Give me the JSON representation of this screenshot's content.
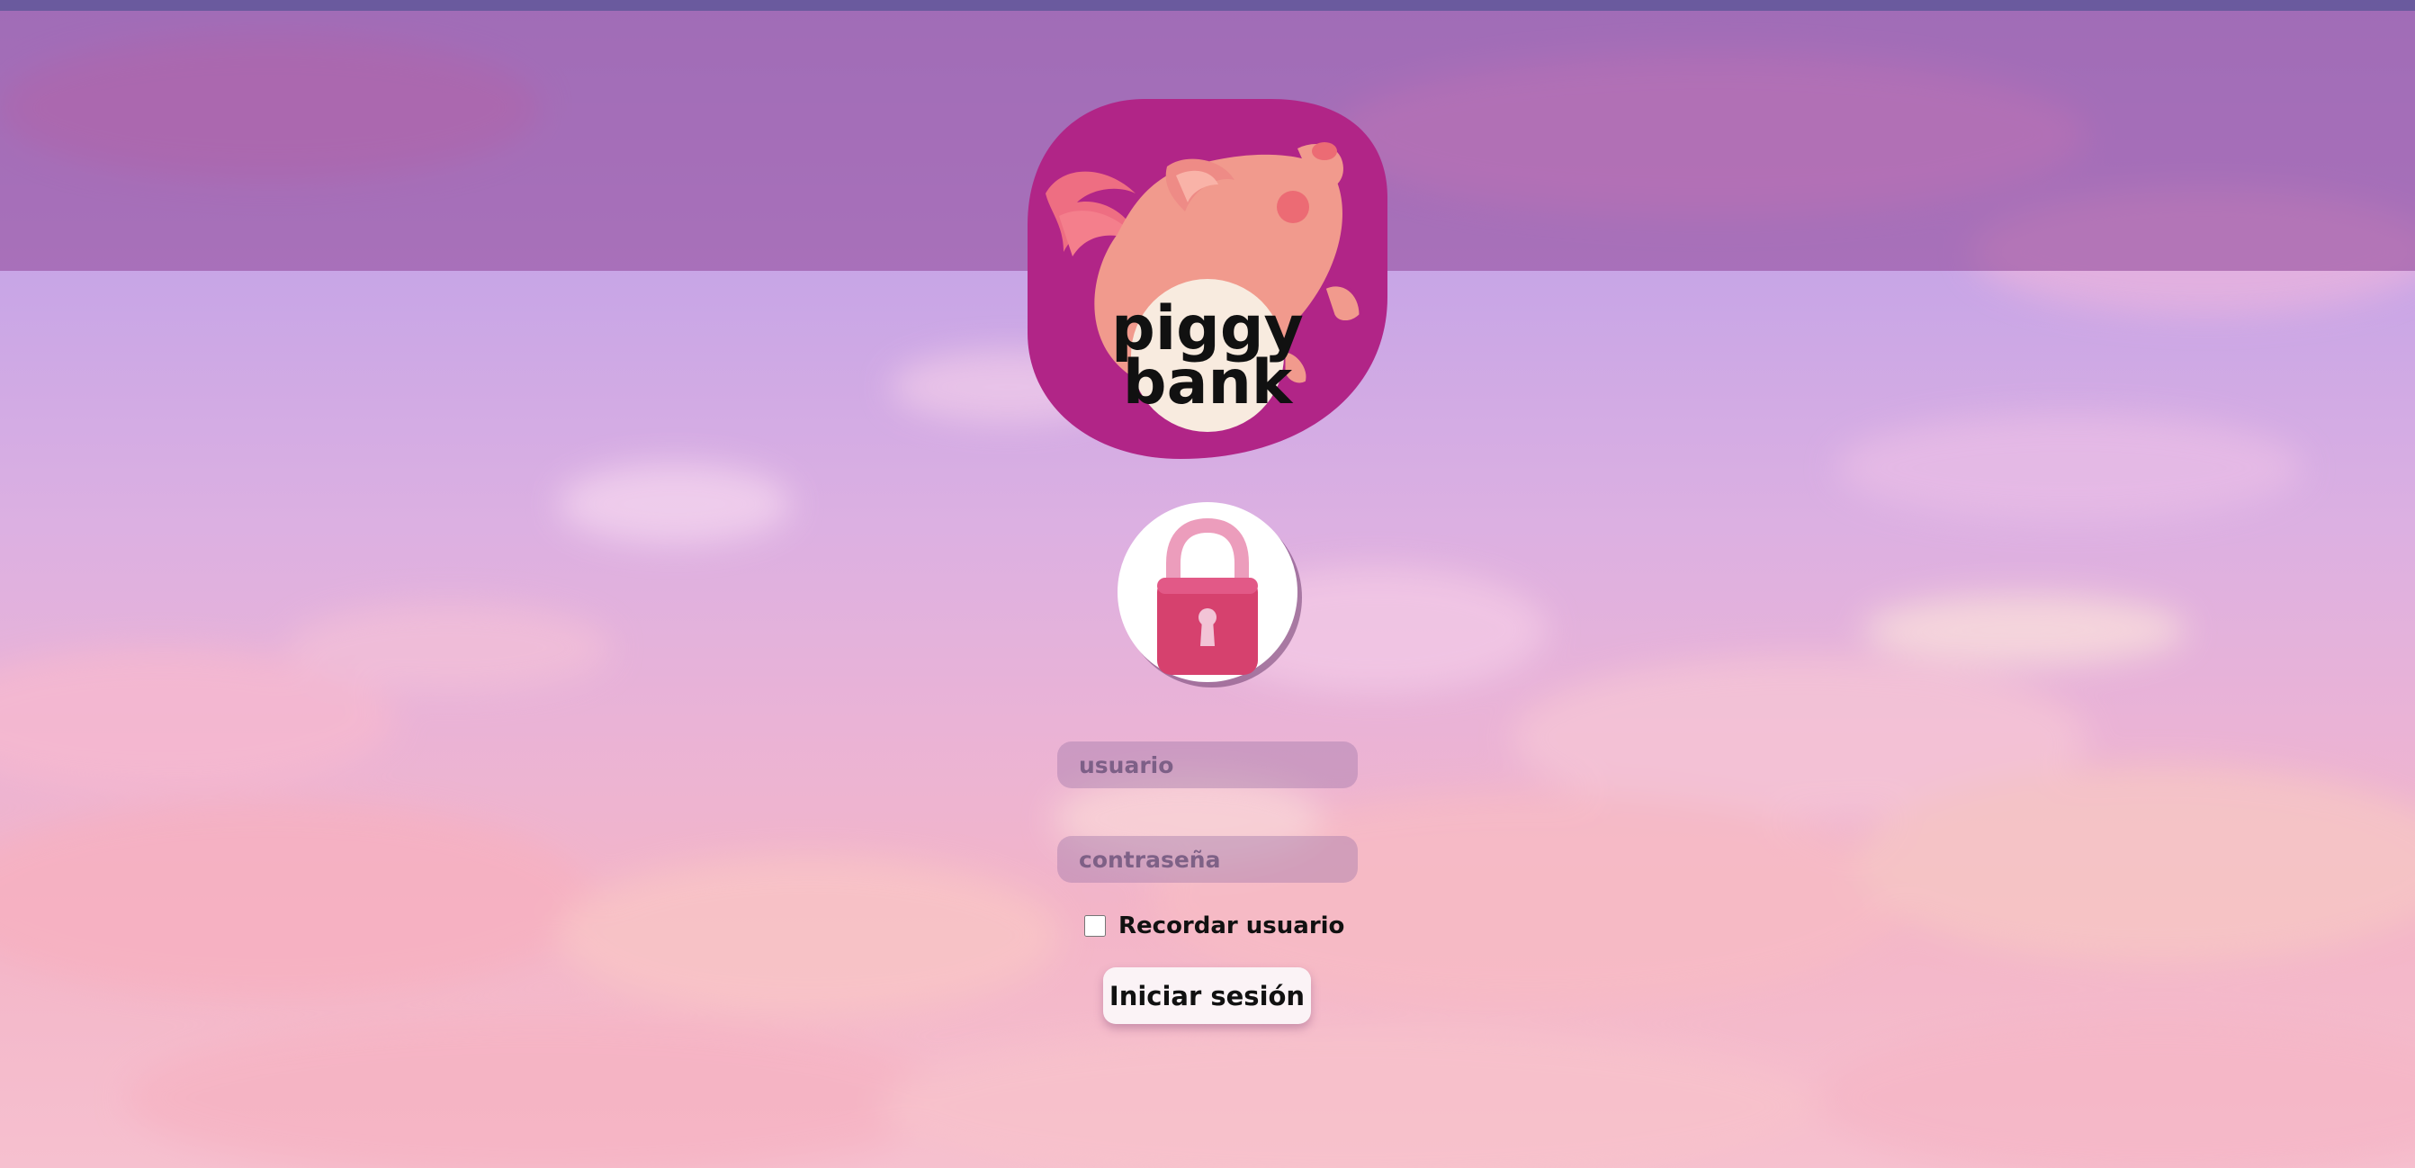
{
  "logo": {
    "line1": "piggy",
    "line2": "bank",
    "icon": "piggy-bank-logo"
  },
  "lock": {
    "icon": "padlock-icon"
  },
  "form": {
    "username_placeholder": "usuario",
    "username_value": "",
    "password_placeholder": "contraseña",
    "password_value": "",
    "remember_label": "Recordar usuario",
    "remember_checked": false,
    "submit_label": "Iniciar sesión"
  },
  "colors": {
    "top_stripe": "#6a5a9e",
    "header_band": "#8e4696",
    "logo_background": "#b12587",
    "pig": "#f19a8d",
    "lock_body": "#d6416e",
    "button_background": "#fbf3f6"
  }
}
